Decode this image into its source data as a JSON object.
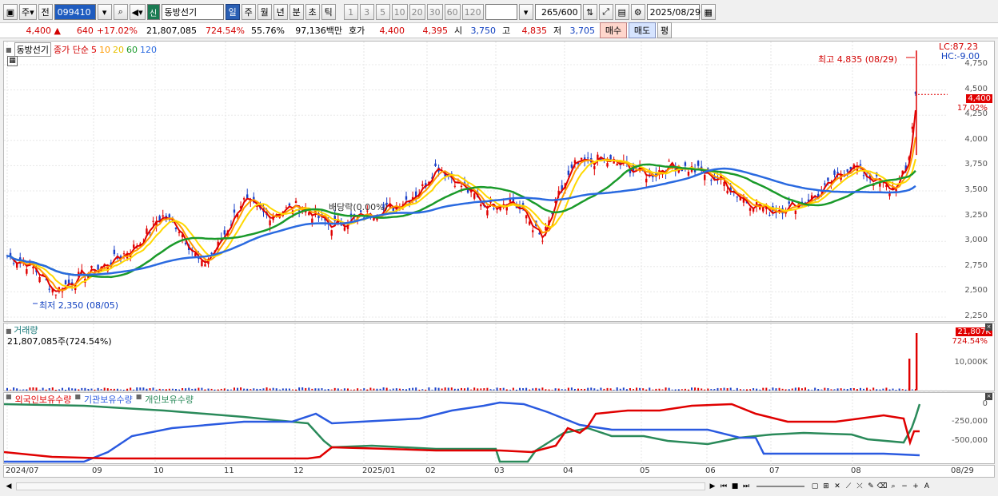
{
  "toolbar": {
    "period_label": "주",
    "prev_label": "전",
    "stock_code": "099410",
    "market_badge": "신",
    "stock_name": "동방선기",
    "intervals": [
      "일",
      "주",
      "월",
      "년",
      "분",
      "초",
      "틱"
    ],
    "active_interval": "일",
    "multipliers": [
      "1",
      "3",
      "5",
      "10",
      "20",
      "30",
      "60",
      "120"
    ],
    "count_value": "265",
    "count_total": "/600",
    "date_value": "2025/08/29"
  },
  "info": {
    "price": "4,400",
    "change": "640",
    "change_pct": "+17.02%",
    "volume": "21,807,085",
    "volume_pct": "724.54%",
    "turnover_pct": "55.76%",
    "amount": "97,136백만",
    "quote_label": "호가",
    "ask": "4,400",
    "bid": "4,395",
    "open_label": "시",
    "open": "3,750",
    "high_label": "고",
    "high": "4,835",
    "low_label": "저",
    "low": "3,705",
    "buy_btn": "매수",
    "sell_btn": "매도",
    "eval_btn": "평"
  },
  "price_panel": {
    "legend_name": "동방선기",
    "ma_label": "종가 단순",
    "ma_periods": [
      "5",
      "10",
      "20",
      "60",
      "120"
    ],
    "ma_colors": [
      "#e00000",
      "#ff9a00",
      "#ffd800",
      "#1a9a2a",
      "#2a6ae0"
    ],
    "lc": "LC:87.23",
    "hc": "HC:-9.00",
    "y_ticks": [
      "4,750",
      "4,500",
      "4,250",
      "4,000",
      "3,750",
      "3,500",
      "3,250",
      "3,000",
      "2,750",
      "2,500",
      "2,250"
    ],
    "last_badge": "4,400",
    "last_pct": "17.02%",
    "high_annot": "최고 4,835 (08/29)",
    "low_annot": "최저 2,350 (08/05)",
    "dividend_annot": "배당락(0.00%)"
  },
  "volume_panel": {
    "title": "거래량",
    "value": "21,807,085주(724.54%)",
    "badge": "21,807K",
    "badge_pct": "724.54%",
    "tick": "10,000K"
  },
  "holding_panel": {
    "series": [
      "외국인보유수량",
      "기관보유수량",
      "개인보유수량"
    ],
    "colors": [
      "#e00000",
      "#2a5ae0",
      "#2a8a5a"
    ],
    "ticks": [
      "0",
      "-250,000",
      "-500,000"
    ]
  },
  "x_axis": {
    "labels": [
      "2024/07",
      "09",
      "10",
      "11",
      "12",
      "2025/01",
      "02",
      "03",
      "04",
      "05",
      "06",
      "07",
      "08"
    ],
    "last": "08/29"
  }
}
